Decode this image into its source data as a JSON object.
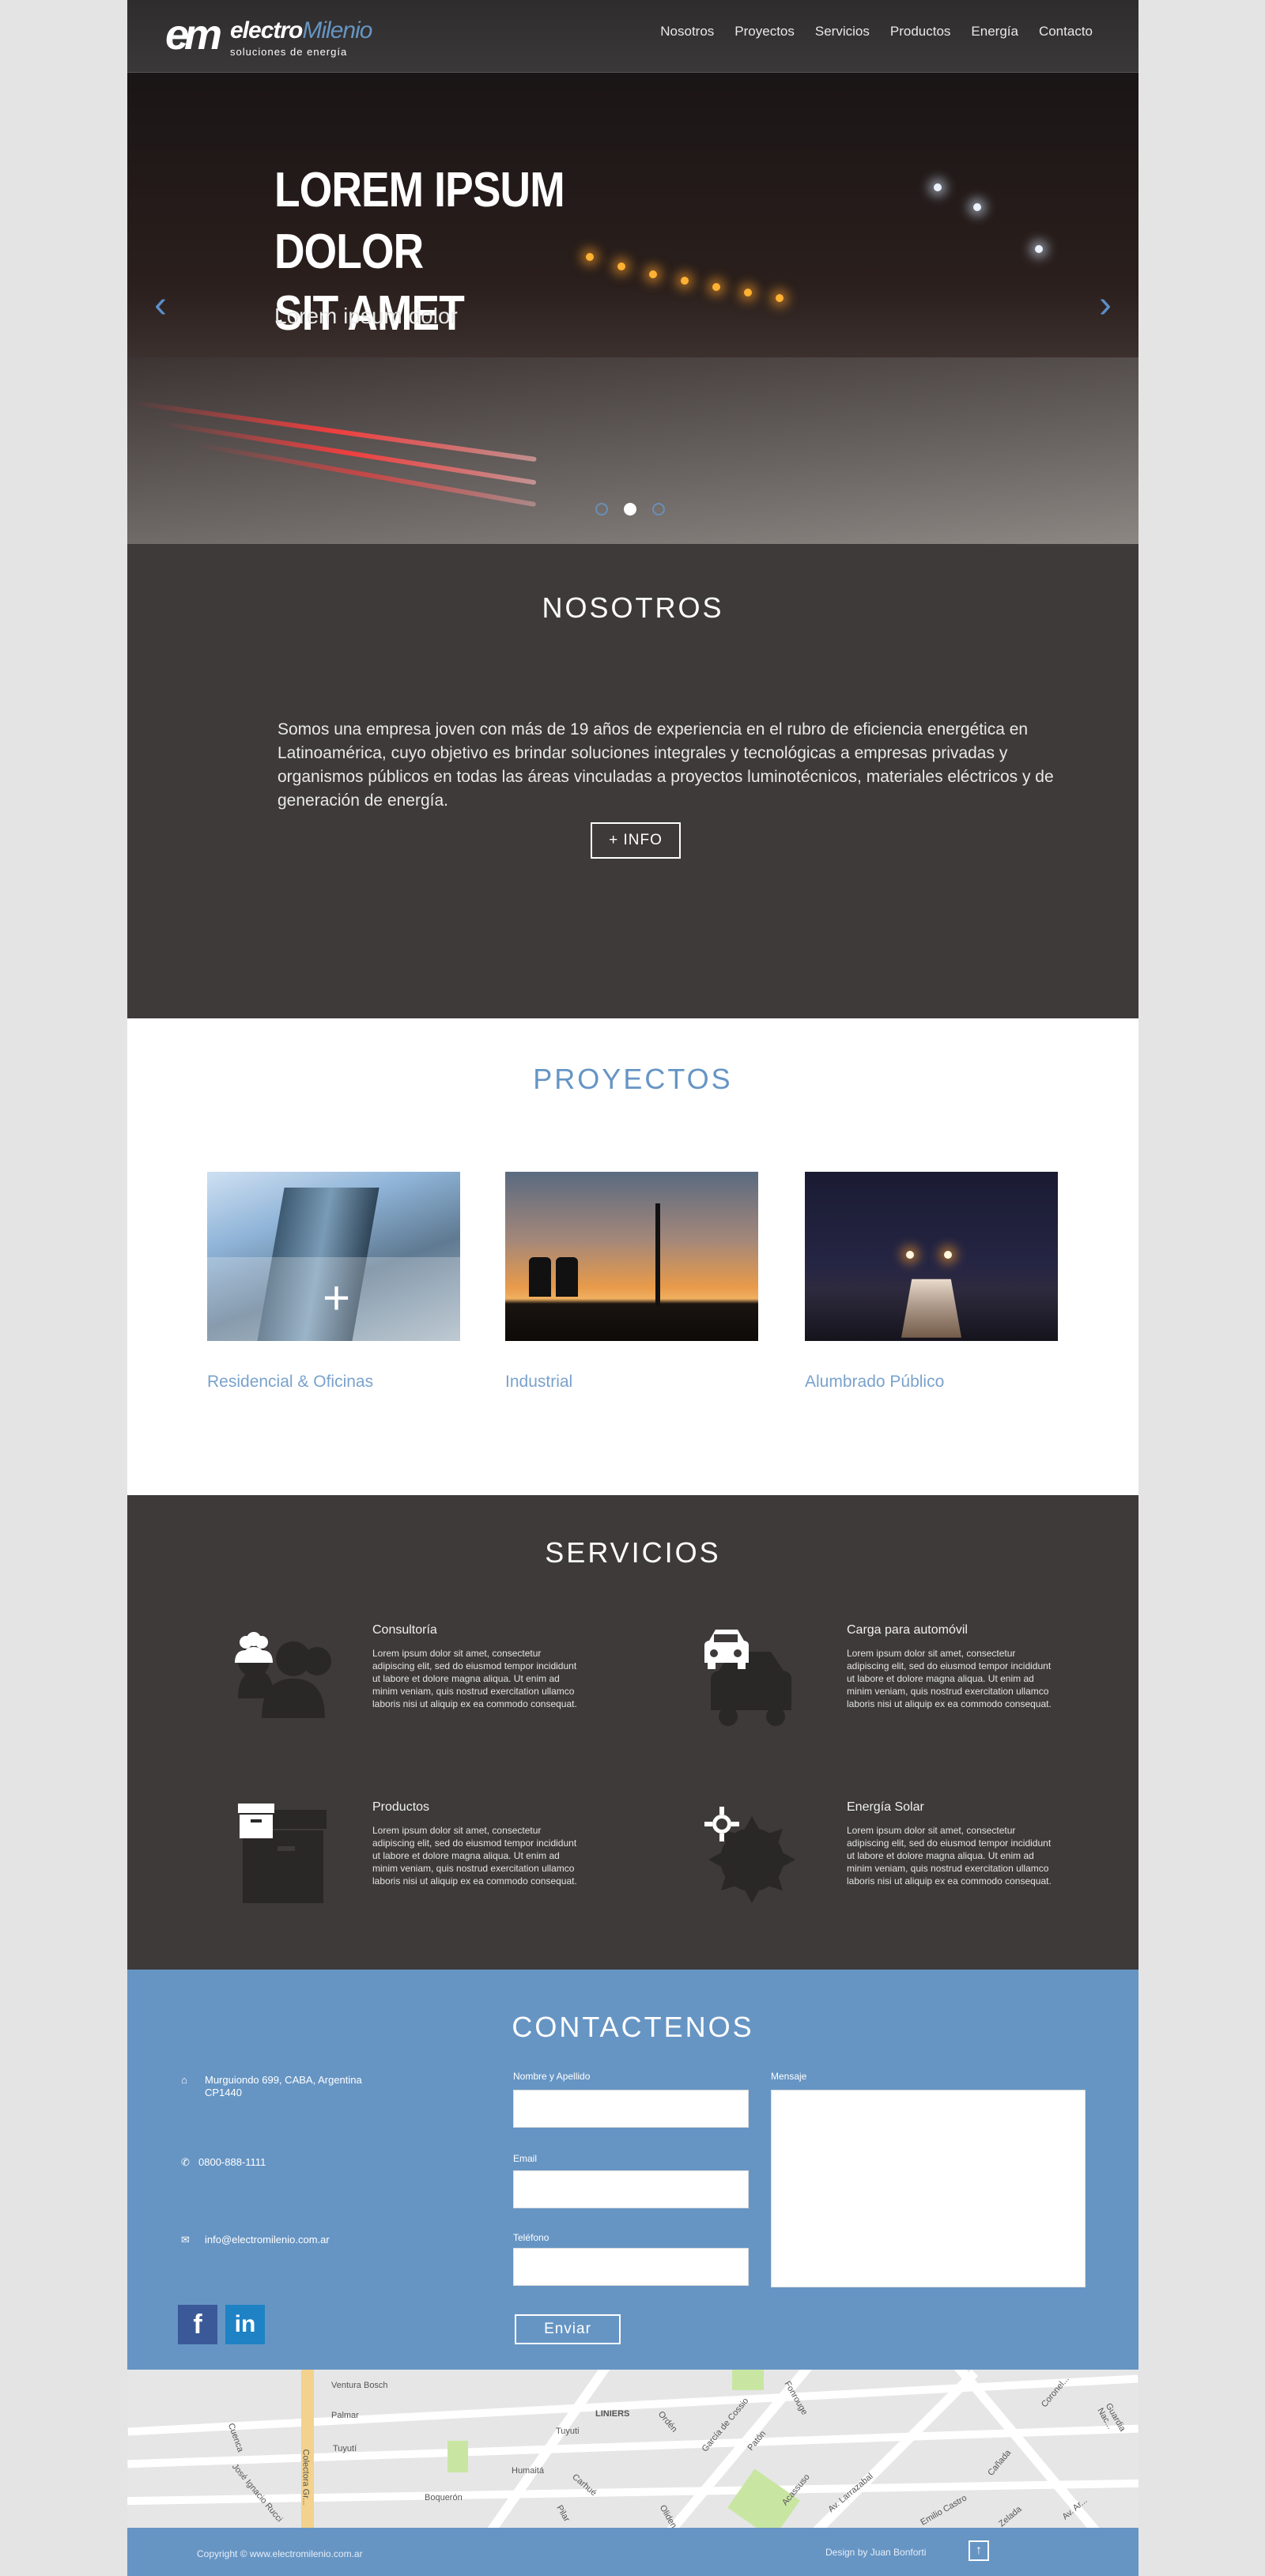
{
  "brand": {
    "mark": "em",
    "name_bold": "electro",
    "name_light": "Milenio",
    "tagline": "soluciones de energía"
  },
  "nav": {
    "items": [
      "Nosotros",
      "Proyectos",
      "Servicios",
      "Productos",
      "Energía",
      "Contacto"
    ]
  },
  "hero": {
    "title_line1": "LOREM IPSUM DOLOR",
    "title_line2": "SIT AMET",
    "subtitle": "Lorem ipsum dolor",
    "prev": "‹",
    "next": "›",
    "active_slide": 2,
    "slide_count": 3
  },
  "nosotros": {
    "title": "NOSOTROS",
    "text": "Somos una empresa joven con más de 19 años de experiencia en el rubro de eficiencia energética en Latinoamérica, cuyo objetivo es brindar soluciones integrales y tecnológicas a empresas privadas y organismos públicos en todas las áreas vinculadas a proyectos luminotécnicos, materiales eléctricos y de  generación de energía.",
    "button": "+ INFO"
  },
  "proyectos": {
    "title": "PROYECTOS",
    "items": [
      {
        "caption": "Residencial & Oficinas"
      },
      {
        "caption": "Industrial"
      },
      {
        "caption": "Alumbrado Público"
      }
    ],
    "overlay_icon": "+"
  },
  "servicios": {
    "title": "SERVICIOS",
    "items": [
      {
        "title": "Consultoría",
        "icon": "group-icon",
        "text": "Lorem ipsum dolor sit amet, consectetur adipiscing elit, sed do eiusmod tempor incididunt ut labore et dolore magna aliqua. Ut enim ad minim veniam, quis nostrud exercitation ullamco laboris nisi ut aliquip ex ea commodo consequat."
      },
      {
        "title": "Carga para automóvil",
        "icon": "car-icon",
        "text": "Lorem ipsum dolor sit amet, consectetur adipiscing elit, sed do eiusmod tempor incididunt ut labore et dolore magna aliqua. Ut enim ad minim veniam, quis nostrud exercitation ullamco laboris nisi ut aliquip ex ea commodo consequat."
      },
      {
        "title": "Productos",
        "icon": "archive-box-icon",
        "text": "Lorem ipsum dolor sit amet, consectetur adipiscing elit, sed do eiusmod tempor incididunt ut labore et dolore magna aliqua. Ut enim ad minim veniam, quis nostrud exercitation ullamco laboris nisi ut aliquip ex ea commodo consequat."
      },
      {
        "title": "Energía Solar",
        "icon": "sun-icon",
        "text": "Lorem ipsum dolor sit amet, consectetur adipiscing elit, sed do eiusmod tempor incididunt ut labore et dolore magna aliqua. Ut enim ad minim veniam, quis nostrud exercitation ullamco laboris nisi ut aliquip ex ea commodo consequat."
      }
    ]
  },
  "contacto": {
    "title": "CONTACTENOS",
    "address_line1": "Murguiondo 699, CABA, Argentina",
    "address_line2": "CP1440",
    "phone": "0800-888-1111",
    "email": "info@electromilenio.com.ar",
    "form": {
      "name_label": "Nombre y Apellido",
      "email_label": "Email",
      "phone_label": "Teléfono",
      "message_label": "Mensaje",
      "submit": "Enviar"
    },
    "social": {
      "facebook": "f",
      "linkedin": "in"
    }
  },
  "map": {
    "labels": [
      "Ventura Bosch",
      "Palmar",
      "Tuyutí",
      "Humaitá",
      "Boquerón",
      "Cuenca",
      "José Ignacio Rucci",
      "LINIERS",
      "Tuyuti",
      "Carhué",
      "Pilar",
      "Ordén",
      "García de Cossio",
      "Patón",
      "Fonrouge",
      "Acassuso",
      "Av. Larrazabal",
      "Emilio Castro",
      "Oliden",
      "Cañada",
      "Av. Ar...",
      "Guardia Nac...",
      "Coronel...",
      "Zelada",
      "Colectora Gr..."
    ]
  },
  "footer": {
    "copyright": "Copyright ©  www.electromilenio.com.ar",
    "design": "Design by Juan Bonforti",
    "up_icon": "↑"
  },
  "colors": {
    "dark": "#3e3a3a",
    "accent": "#6695c4",
    "white": "#ffffff"
  }
}
